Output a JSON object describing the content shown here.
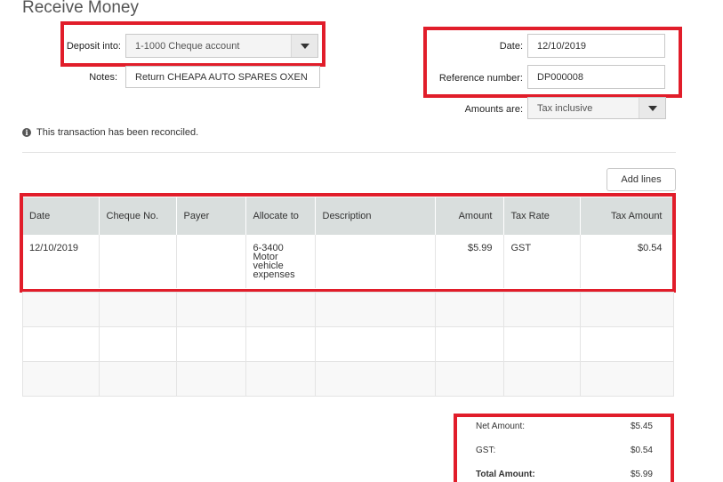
{
  "page": {
    "title": "Receive Money"
  },
  "form": {
    "deposit_label": "Deposit into:",
    "deposit_value": "1-1000 Cheque account",
    "notes_label": "Notes:",
    "notes_value": "Return CHEAPA AUTO SPARES OXEN",
    "date_label": "Date:",
    "date_value": "12/10/2019",
    "reference_label": "Reference number:",
    "reference_value": "DP000008",
    "amounts_label": "Amounts are:",
    "amounts_value": "Tax inclusive"
  },
  "info": {
    "reconciled_text": "This transaction has been reconciled.",
    "icon": "info-icon"
  },
  "toolbar": {
    "add_lines_label": "Add lines"
  },
  "table": {
    "headers": [
      "Date",
      "Cheque No.",
      "Payer",
      "Allocate to",
      "Description",
      "Amount",
      "Tax Rate",
      "Tax Amount"
    ],
    "rows": [
      {
        "date": "12/10/2019",
        "cheque_no": "",
        "payer": "",
        "allocate_to": "6-3400 Motor vehicle expenses",
        "description": "",
        "amount": "$5.99",
        "tax_rate": "GST",
        "tax_amount": "$0.54"
      }
    ]
  },
  "totals": {
    "net_label": "Net Amount:",
    "net_value": "$5.45",
    "gst_label": "GST:",
    "gst_value": "$0.54",
    "total_label": "Total Amount:",
    "total_value": "$5.99"
  },
  "colors": {
    "highlight": "#e11d2a",
    "header_bg": "#d9dedd"
  }
}
